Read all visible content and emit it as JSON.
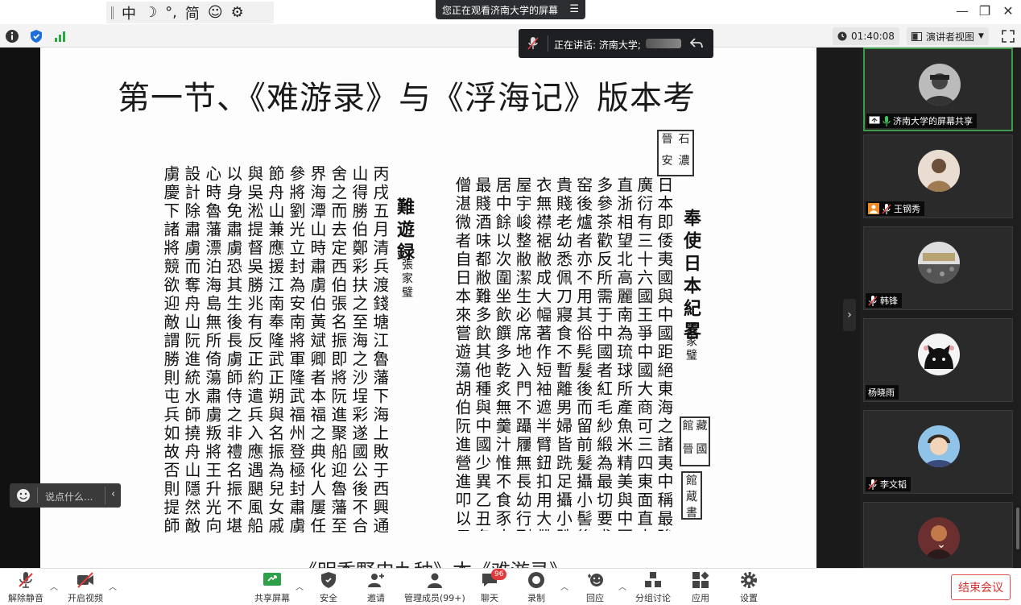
{
  "titlebar": {
    "ime": {
      "mode": "中",
      "moon": "☽",
      "punct": "°,",
      "simplified": "简",
      "emoji": "☺",
      "settings": "⚙"
    },
    "viewing_banner": "您正在观看济南大学的屏幕"
  },
  "infobar": {
    "timer": "01:40:08",
    "view_mode": "演讲者视图"
  },
  "speaking": {
    "label": "正在讲话: 济南大学;"
  },
  "slide": {
    "title": "第一节、《难游录》与《浮海记》版本考",
    "caption": "《明季野史九种》本《难游录》",
    "right_scan": {
      "heading": "奉使日本紀畧",
      "author": "張家璧",
      "columns": [
        "日本即倭夷國與中國距絕東海之諸夷中稱最強土地",
        "廣衍有三十六國王爭中國大商可三四東面直大故與",
        "直浙相望北高麗南為琉球所產魚米精美與中國無",
        "多參茶歡反所需于中國者紅毛紗緞為最切要尤重古",
        "窑後爐者亦不用其俗髡髮後而留前髮攝小髻後垂",
        "貴賤老幼悉佩刀寢食不暫離男婦皆跣足攝小跣皮靴",
        "衣無襟裾敝成大幅著作短袖遮半臂鈕扣用大帶圍腰",
        "屋宇峻整敝潔生必席地入門不躡屨無長幼行列尊者",
        "居中餘以次圍坐飲饌多乾炙無羹汁惟不食豕肉跂嗜",
        "最賤酒味都敝難多飲其他種與中國少異乙丑冬有",
        "僧湛微者自日本來嘗遊蕩胡伯阮進營進叩以日南風"
      ]
    },
    "left_scan": {
      "heading": "難遊録",
      "author": "張家璧",
      "columns": [
        "丙戌五月清兵渡錢塘江魯藩下海上敗于西興通走舟",
        "山得勝伯鄭彩扶之至海之沙埕彩遂國公後不合",
        "舍之而去定西伯張名振即將阮進聚船迎魯藩至福清",
        "界海潭山時肅虜伯黃斌卿者本福之典化人屢任舟山",
        "參將劉光立封為安南將軍隆武福州登極封肅虜伯建",
        "節舟山兼應援江南奉隆武正朔與名振為兒女戚會",
        "與吳淞提督吳勝兆有反正約遣兵入應遇颶風船壞僅",
        "以身免肅虜恐其生後長虜師侍之非禮名振不堪遂有二",
        "心時魯藩漂泊海島無所倚蕩肅虜叛將王升光向魯藩",
        "設計除肅虜而奪舟山阮進統水師撓舟山隱然敵國肅",
        "虜慶下諸將競欲迎敵謂勝則屯兵如故否則提師入閩"
      ]
    },
    "seal_top": [
      "晉",
      "石",
      "安",
      "濃",
      "館",
      "藏"
    ],
    "seal_bottom": [
      "晉",
      "國",
      "館",
      "蔵",
      "書",
      "印"
    ]
  },
  "chat": {
    "placeholder": "说点什么..."
  },
  "participants": [
    {
      "name": "济南大学的屏幕共享",
      "active": true
    },
    {
      "name": "王钢秀",
      "active": false
    },
    {
      "name": "韩锋",
      "active": false
    },
    {
      "name": "杨晓雨",
      "active": false
    },
    {
      "name": "李文韬",
      "active": false
    },
    {
      "name": "",
      "active": false
    }
  ],
  "toolbar": {
    "unmute": "解除静音",
    "video": "开启视频",
    "share": "共享屏幕",
    "security": "安全",
    "invite": "邀请",
    "members": "管理成员(99+)",
    "chat": "聊天",
    "chat_badge": "96",
    "record": "录制",
    "reactions": "回应",
    "breakout": "分组讨论",
    "apps": "应用",
    "settings": "设置",
    "end": "结束会议"
  },
  "colors": {
    "active_border": "#3f9a4a",
    "end_button": "#d43030",
    "badge": "#e23b3b"
  }
}
